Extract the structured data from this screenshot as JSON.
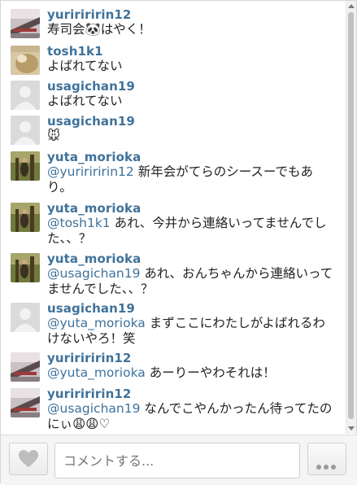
{
  "comments": [
    {
      "user": "yuririririn12",
      "mention": "",
      "text": "寿司会🐼はやく！",
      "avatar": "grill-photo"
    },
    {
      "user": "tosh1k1",
      "mention": "",
      "text": "よばれてない",
      "avatar": "cat-photo"
    },
    {
      "user": "usagichan19",
      "mention": "",
      "text": "よばれてない",
      "avatar": "default"
    },
    {
      "user": "usagichan19",
      "mention": "",
      "text": "🐭",
      "avatar": "default"
    },
    {
      "user": "yuta_morioka",
      "mention": "@yuririririn12",
      "text": " 新年会がてらのシースーでもあり。",
      "avatar": "forest-photo"
    },
    {
      "user": "yuta_morioka",
      "mention": "@tosh1k1",
      "text": " あれ、今井から連絡いってませんでした、、？",
      "avatar": "forest-photo"
    },
    {
      "user": "yuta_morioka",
      "mention": "@usagichan19",
      "text": " あれ、おんちゃんから連絡いってませんでした、、？",
      "avatar": "forest-photo"
    },
    {
      "user": "usagichan19",
      "mention": "@yuta_morioka",
      "text": " まずここにわたしがよばれるわけないやろ！笑",
      "avatar": "default"
    },
    {
      "user": "yuririririn12",
      "mention": "@yuta_morioka",
      "text": " あーりーやわそれは！",
      "avatar": "grill-photo"
    },
    {
      "user": "yuririririn12",
      "mention": "@usagichan19",
      "text": " なんでこやんかったん待ってたのにぃ😩😩♡",
      "avatar": "grill-photo"
    }
  ],
  "footer": {
    "comment_placeholder": "コメントする...",
    "like_icon": "heart-icon",
    "more_icon": "ellipsis-icon"
  }
}
